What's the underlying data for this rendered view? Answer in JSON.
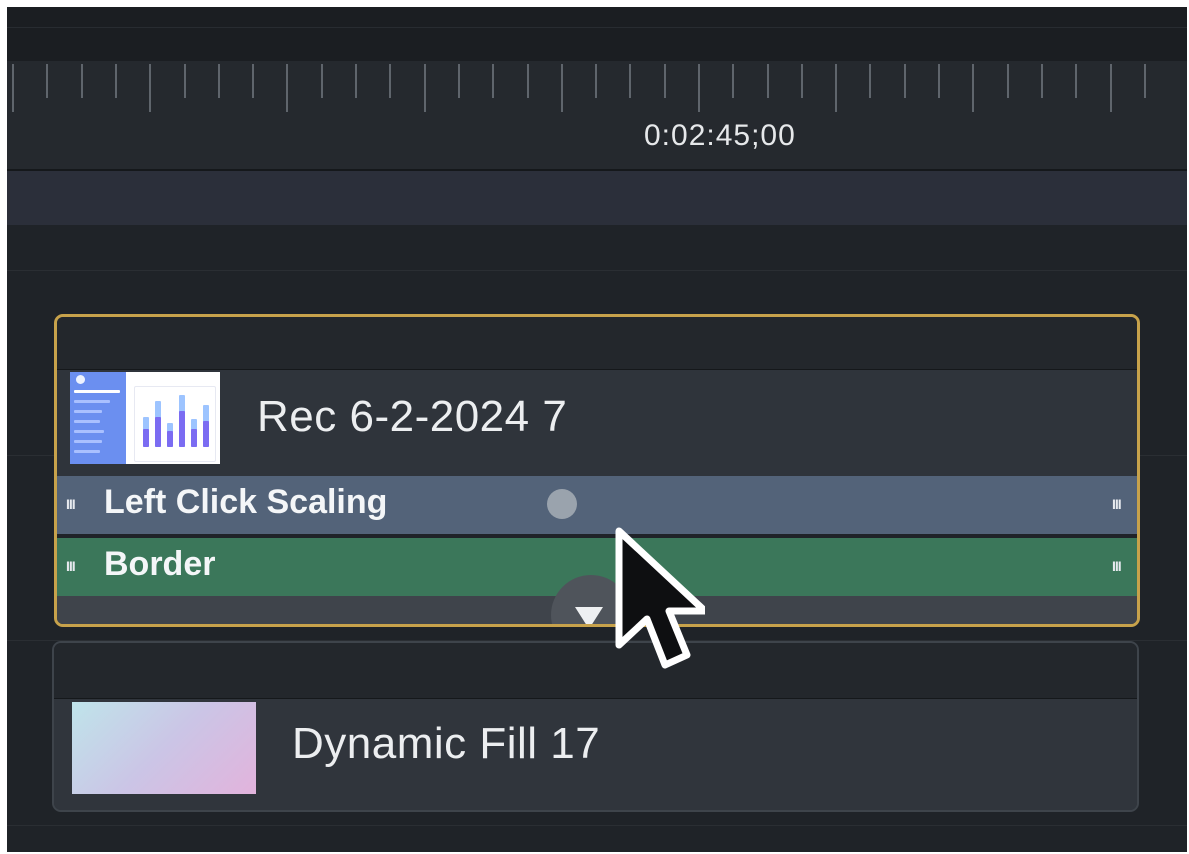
{
  "ruler": {
    "timecode": "0:02:45;00"
  },
  "clips": {
    "recording": {
      "title": "Rec 6-2-2024 7",
      "thumbnail": "screen-recording-dashboard-thumbnail",
      "selected_border_color": "#c7a24b",
      "effects": [
        {
          "label": "Left Click Scaling",
          "color": "#536379",
          "grip": "III"
        },
        {
          "label": "Border",
          "color": "#3b775a",
          "grip": "III"
        }
      ]
    },
    "fill": {
      "title": "Dynamic Fill 17",
      "thumbnail": "gradient-thumbnail"
    }
  },
  "icons": {
    "expand": "triangle-down-icon",
    "cursor": "mouse-pointer-icon",
    "handle": "circle-handle-icon"
  }
}
